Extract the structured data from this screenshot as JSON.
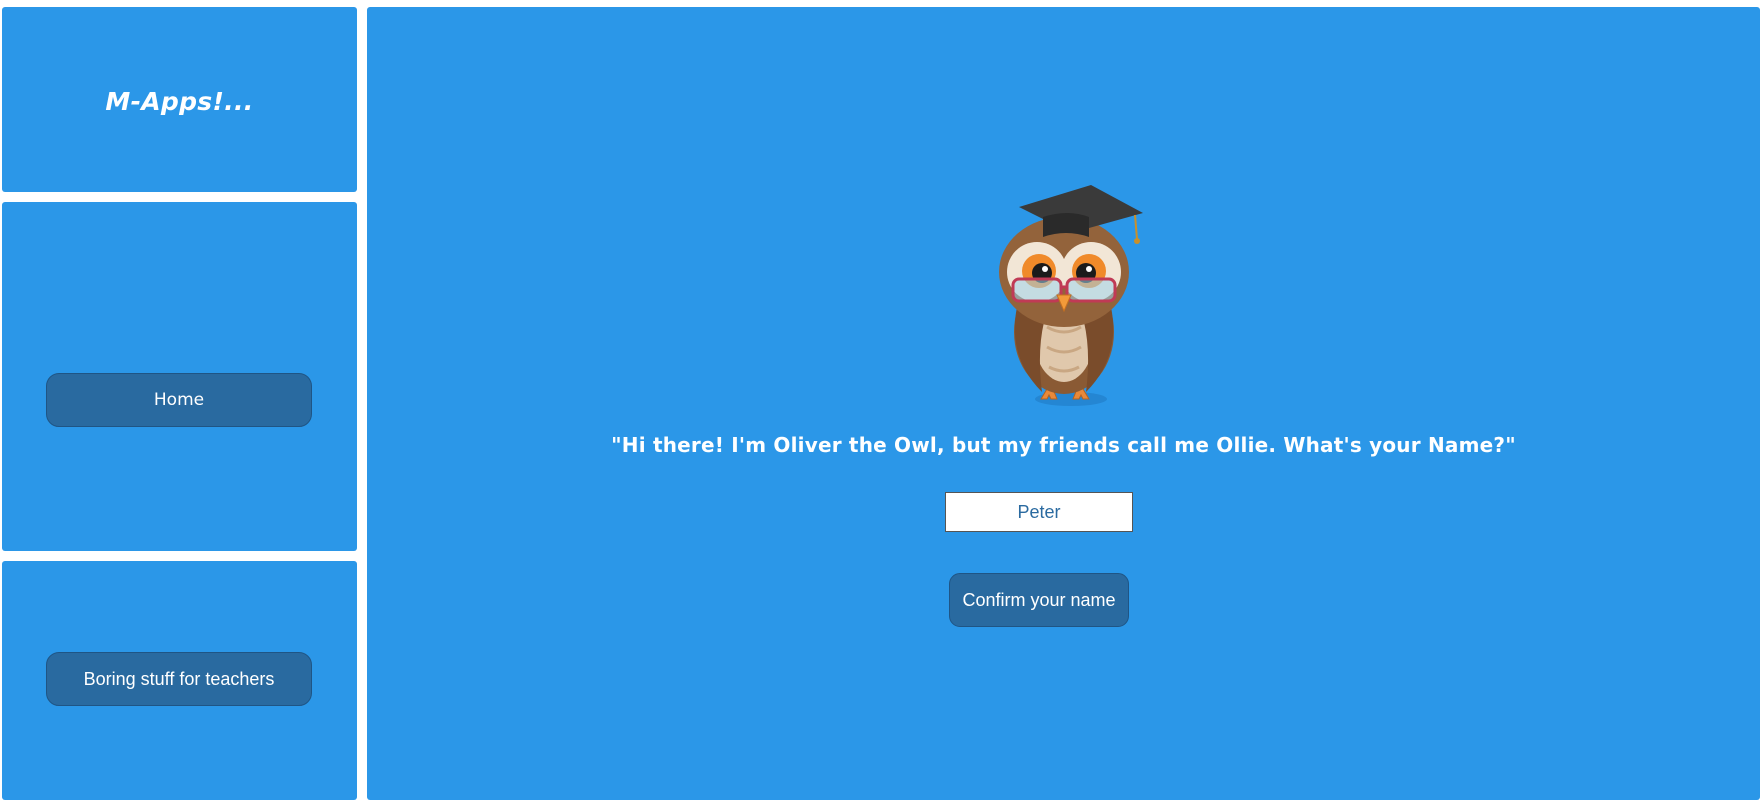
{
  "brand": {
    "logo_text": "M-Apps!..."
  },
  "sidebar": {
    "home_label": "Home",
    "teachers_label": "Boring stuff for teachers"
  },
  "main": {
    "mascot_icon": "graduate-owl-icon",
    "speech": "\"Hi there! I'm Oliver the Owl, but my friends call me Ollie. What's your Name?\"",
    "name_input": {
      "value": "Peter"
    },
    "confirm_label": "Confirm your name"
  },
  "colors": {
    "panel_bg": "#2b97e8",
    "button_bg": "#296aa0",
    "text": "#ffffff"
  }
}
